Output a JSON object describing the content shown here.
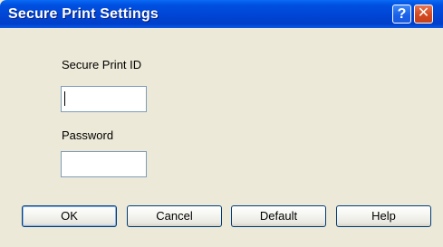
{
  "window": {
    "title": "Secure Print Settings",
    "help_glyph": "?",
    "close_glyph": "✕"
  },
  "form": {
    "secure_print_id_label": "Secure Print ID",
    "secure_print_id_value": "",
    "password_label": "Password",
    "password_value": ""
  },
  "buttons": {
    "ok": "OK",
    "cancel": "Cancel",
    "default": "Default",
    "help": "Help"
  },
  "icons": {
    "help": "question-mark-icon",
    "close": "close-x-icon"
  }
}
